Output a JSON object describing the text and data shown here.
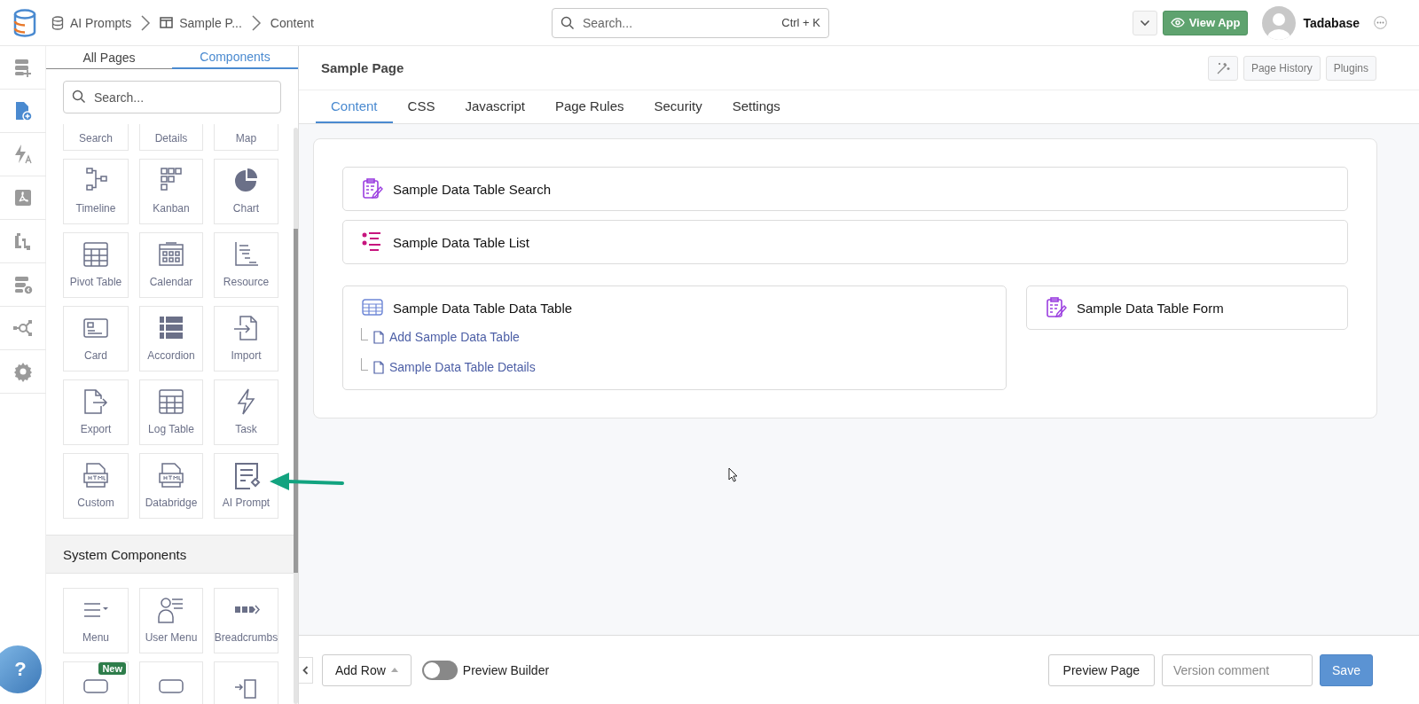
{
  "header": {
    "breadcrumbs": [
      {
        "label": "AI Prompts"
      },
      {
        "label": "Sample P..."
      },
      {
        "label": "Content"
      }
    ],
    "search": {
      "placeholder": "Search...",
      "shortcut": "Ctrl + K"
    },
    "view_app": "View App",
    "user": "Tadabase"
  },
  "rail": {
    "items": [
      {
        "selected": false
      },
      {
        "selected": true
      },
      {
        "selected": false
      },
      {
        "selected": false
      },
      {
        "selected": false
      },
      {
        "selected": false
      },
      {
        "selected": false
      },
      {
        "selected": false
      }
    ]
  },
  "help": "?",
  "panel": {
    "tabs": [
      {
        "label": "All Pages",
        "selected": false
      },
      {
        "label": "Components",
        "selected": true
      }
    ],
    "search": {
      "placeholder": "Search..."
    },
    "components": [
      {
        "label": "Search",
        "kind": "cut"
      },
      {
        "label": "Details",
        "kind": "cut"
      },
      {
        "label": "Map",
        "kind": "cut"
      },
      {
        "label": "Timeline",
        "kind": "tile"
      },
      {
        "label": "Kanban",
        "kind": "tile"
      },
      {
        "label": "Chart",
        "kind": "tile"
      },
      {
        "label": "Pivot Table",
        "kind": "tile"
      },
      {
        "label": "Calendar",
        "kind": "tile"
      },
      {
        "label": "Resource",
        "kind": "tile"
      },
      {
        "label": "Card",
        "kind": "tile"
      },
      {
        "label": "Accordion",
        "kind": "tile"
      },
      {
        "label": "Import",
        "kind": "tile"
      },
      {
        "label": "Export",
        "kind": "tile"
      },
      {
        "label": "Log Table",
        "kind": "tile"
      },
      {
        "label": "Task",
        "kind": "tile"
      },
      {
        "label": "Custom",
        "kind": "tile"
      },
      {
        "label": "Databridge",
        "kind": "tile"
      },
      {
        "label": "AI Prompt",
        "kind": "tile"
      }
    ],
    "system_title": "System Components",
    "system_components": [
      {
        "label": "Menu",
        "kind": "tile"
      },
      {
        "label": "User Menu",
        "kind": "tile"
      },
      {
        "label": "Breadcrumbs",
        "kind": "tile"
      },
      {
        "badge": "New",
        "kind": "partial"
      },
      {
        "kind": "partial"
      },
      {
        "kind": "partial"
      }
    ]
  },
  "main": {
    "page_title": "Sample Page",
    "toolbar": [
      "Page History",
      "Plugins"
    ],
    "tabs": [
      {
        "label": "Content",
        "selected": true
      },
      {
        "label": "CSS",
        "selected": false
      },
      {
        "label": "Javascript",
        "selected": false
      },
      {
        "label": "Page Rules",
        "selected": false
      },
      {
        "label": "Security",
        "selected": false
      },
      {
        "label": "Settings",
        "selected": false
      }
    ],
    "rows": [
      {
        "components": [
          {
            "title": "Sample Data Table Search",
            "kind": "search"
          }
        ]
      },
      {
        "components": [
          {
            "title": "Sample Data Table List",
            "kind": "list"
          }
        ]
      },
      {
        "components": [
          {
            "title": "Sample Data Table Data Table",
            "kind": "table",
            "children": [
              {
                "title": "Add Sample Data Table"
              },
              {
                "title": "Sample Data Table Details"
              }
            ]
          },
          {
            "title": "Sample Data Table Form",
            "kind": "form"
          }
        ]
      }
    ]
  },
  "footer": {
    "add_row": "Add Row",
    "preview_builder": {
      "label": "Preview Builder",
      "on": false
    },
    "preview_page": "Preview Page",
    "version": {
      "placeholder": "Version comment"
    },
    "save": "Save"
  }
}
